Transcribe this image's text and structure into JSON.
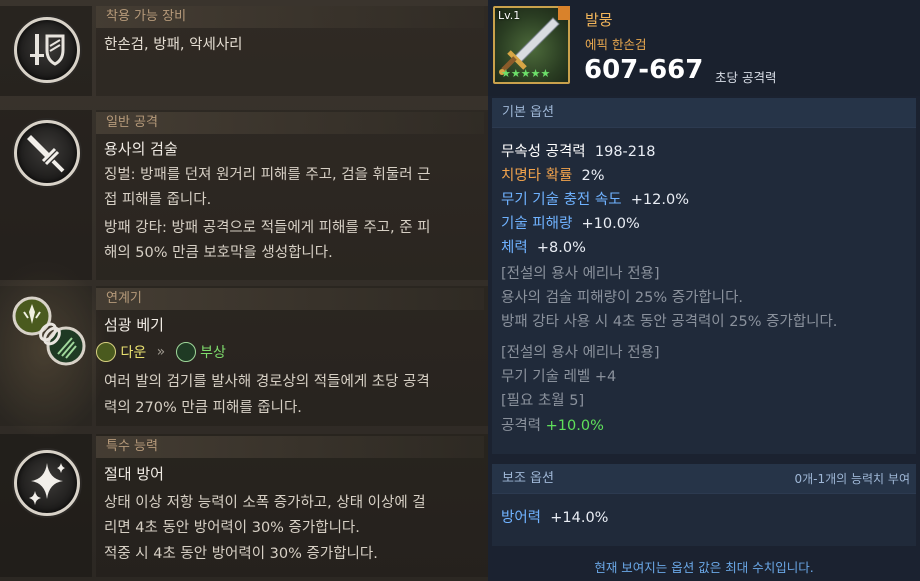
{
  "left": {
    "section1": {
      "header": "착용 가능 장비",
      "icon": "sword-shield-icon",
      "text": "한손검, 방패, 악세사리"
    },
    "section2": {
      "header": "일반 공격",
      "icon": "sword-icon",
      "title": "용사의 검술",
      "desc1a": "징벌: 방패를 던져 원거리 피해를 주고, 검을 휘둘러 근",
      "desc1b": "접 피해를 줍니다.",
      "desc2a": "방패 강타: 방패 공격으로 적들에게 피해를 주고, 준 피",
      "desc2b": "해의 50% 만큼 보호막을 생성합니다."
    },
    "section3": {
      "header": "연계기",
      "icon": "chain-icon",
      "title": "섬광 베기",
      "combo_from": "다운",
      "combo_arrow": "»",
      "combo_to": "부상",
      "desc1": "여러 발의 검기를 발사해 경로상의 적들에게 초당 공격",
      "desc2": "력의 270% 만큼 피해를 줍니다."
    },
    "section4": {
      "header": "특수 능력",
      "icon": "sparkle-icon",
      "title": "절대 방어",
      "desc1": "상태 이상 저항 능력이 소폭 증가하고, 상태 이상에 걸",
      "desc2": "리면 4초 동안 방어력이 30% 증가합니다.",
      "desc3": "적중 시 4초 동안 방어력이 30% 증가합니다."
    }
  },
  "item": {
    "level": "Lv.1",
    "stars": "★★★★★",
    "name": "발뭉",
    "type": "에픽 한손검",
    "attack": "607-667",
    "attack_label": "초당 공격력"
  },
  "base_options": {
    "header": "기본 옵션",
    "lines": [
      {
        "k": "무속성 공격력",
        "v": "198-218"
      },
      {
        "k": "치명타 확률",
        "v": "2%"
      },
      {
        "k": "무기 기술 충전 속도",
        "v": "+12.0%"
      },
      {
        "k": "기술 피해량",
        "v": "+10.0%"
      },
      {
        "k": "체력",
        "v": "+8.0%"
      }
    ],
    "exclusive1_title": "[전설의 용사 에리나 전용]",
    "exclusive1_line1": "용사의 검술 피해량이 25% 증가합니다.",
    "exclusive1_line2": "방패 강타 사용 시 4초 동안 공격력이 25% 증가합니다.",
    "exclusive2_title": "[전설의 용사 에리나 전용]",
    "exclusive2_line1": "무기 기술 레벨 +4",
    "exclusive2_line2": "[필요 초월 5]",
    "exclusive2_line3_k": "공격력",
    "exclusive2_line3_v": "+10.0%"
  },
  "sub_options": {
    "header": "보조 옵션",
    "note": "0개-1개의 능력치 부여",
    "line_k": "방어력",
    "line_v": "+14.0%"
  },
  "footer": "현재 보여지는 옵션 값은 최대 수치입니다.",
  "colors": {
    "accent_gold": "#f0b45a",
    "stat_blue": "#6fb2ff",
    "bonus_green": "#5fe05a"
  }
}
